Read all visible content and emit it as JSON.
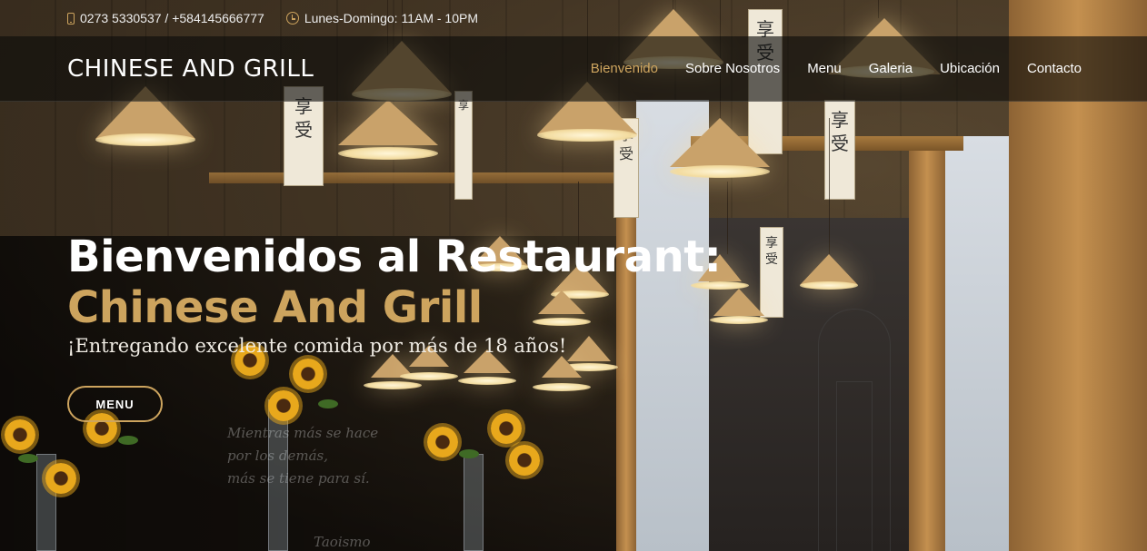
{
  "topbar": {
    "phone": "0273 5330537 / +584145666777",
    "hours": "Lunes-Domingo: 11AM - 10PM",
    "phone_icon": "mobile-phone-icon",
    "hours_icon": "clock-icon"
  },
  "header": {
    "logo": "CHINESE AND GRILL",
    "nav": [
      {
        "label": "Bienvenido",
        "active": true
      },
      {
        "label": "Sobre Nosotros",
        "active": false
      },
      {
        "label": "Menu",
        "active": false
      },
      {
        "label": "Galeria",
        "active": false
      },
      {
        "label": "Ubicación",
        "active": false
      },
      {
        "label": "Contacto",
        "active": false
      }
    ]
  },
  "hero": {
    "title_line1": "Bienvenidos al Restaurant:",
    "title_line2": "Chinese And Grill",
    "subtitle": "¡Entregando excelente comida por más de 18 años!",
    "button_label": "MENU"
  },
  "mural": {
    "line1": "Mientras más se hace",
    "line2": "por los demás,",
    "line3": "más se tiene para sí.",
    "signature": "Taoismo"
  },
  "colors": {
    "accent": "#cda45e",
    "header_bg": "rgba(12,11,9,0.62)",
    "text": "#ffffff"
  }
}
